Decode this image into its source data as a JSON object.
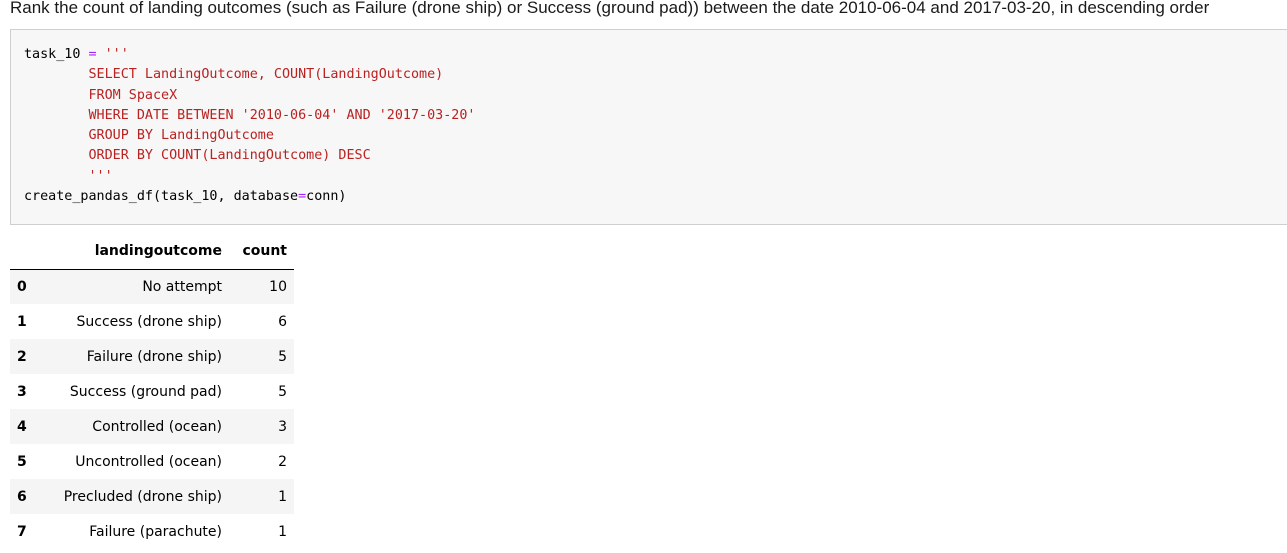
{
  "heading": "Rank the count of landing outcomes (such as Failure (drone ship) or Success (ground pad)) between the date 2010-06-04 and 2017-03-20, in descending order",
  "code": {
    "line1_var": "task_10",
    "line1_op": "=",
    "line1_str": "'''",
    "sql_lines": [
      "        SELECT LandingOutcome, COUNT(LandingOutcome)",
      "        FROM SpaceX",
      "        WHERE DATE BETWEEN '2010-06-04' AND '2017-03-20'",
      "        GROUP BY LandingOutcome",
      "        ORDER BY COUNT(LandingOutcome) DESC",
      "        '''"
    ],
    "last_line_func": "create_pandas_df(task_10, database",
    "last_line_op": "=",
    "last_line_end": "conn)"
  },
  "table": {
    "columns": [
      "",
      "landingoutcome",
      "count"
    ],
    "rows": [
      {
        "index": "0",
        "landingoutcome": "No attempt",
        "count": "10"
      },
      {
        "index": "1",
        "landingoutcome": "Success (drone ship)",
        "count": "6"
      },
      {
        "index": "2",
        "landingoutcome": "Failure (drone ship)",
        "count": "5"
      },
      {
        "index": "3",
        "landingoutcome": "Success (ground pad)",
        "count": "5"
      },
      {
        "index": "4",
        "landingoutcome": "Controlled (ocean)",
        "count": "3"
      },
      {
        "index": "5",
        "landingoutcome": "Uncontrolled (ocean)",
        "count": "2"
      },
      {
        "index": "6",
        "landingoutcome": "Precluded (drone ship)",
        "count": "1"
      },
      {
        "index": "7",
        "landingoutcome": "Failure (parachute)",
        "count": "1"
      }
    ]
  }
}
